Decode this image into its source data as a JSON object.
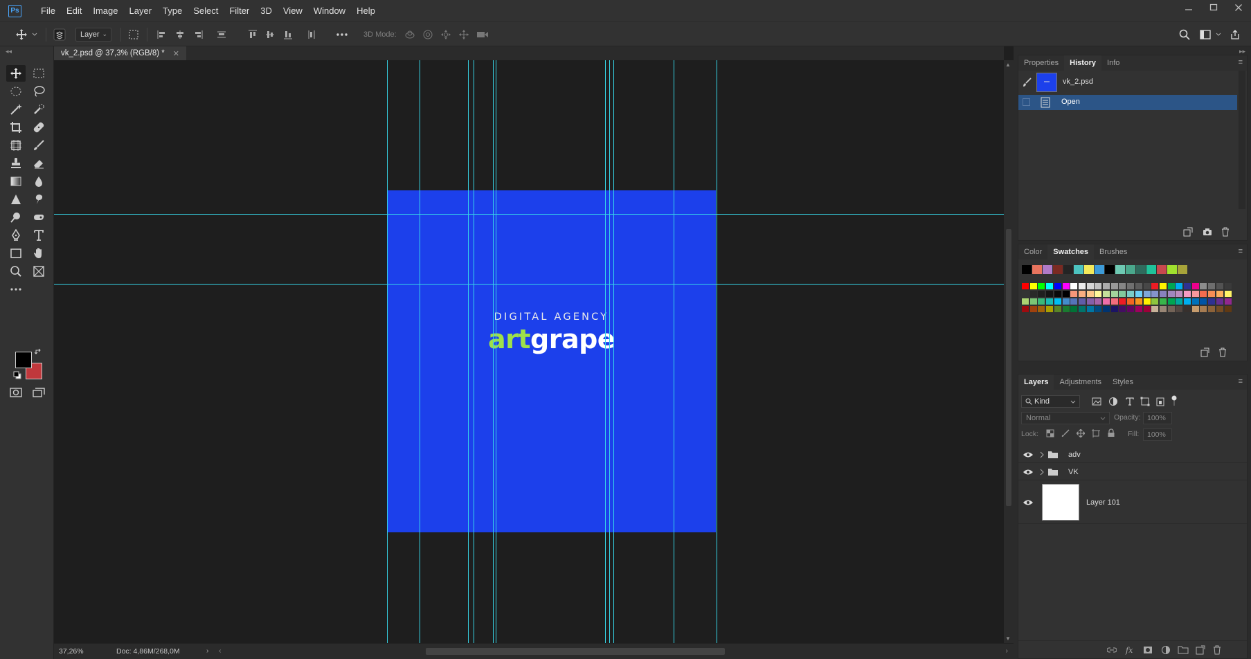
{
  "app": {
    "logo_text": "Ps"
  },
  "menu": [
    "File",
    "Edit",
    "Image",
    "Layer",
    "Type",
    "Select",
    "Filter",
    "3D",
    "View",
    "Window",
    "Help"
  ],
  "options_bar": {
    "auto_select_target": "Layer",
    "mode_3d_label": "3D Mode:"
  },
  "document": {
    "tab_title": "vk_2.psd @ 37,3% (RGB/8) *",
    "logo_subtitle": "DIGITAL AGENCY",
    "logo_part1": "art",
    "logo_part2": "grape",
    "artboard_color": "#1c40eb",
    "guide_color": "#36d6e8"
  },
  "status": {
    "zoom": "37,26%",
    "doc_info": "Doc: 4,86M/268,0M"
  },
  "history_panel": {
    "tabs": [
      "Properties",
      "History",
      "Info"
    ],
    "active_tab": "History",
    "snapshot_name": "vk_2.psd",
    "states": [
      "Open"
    ]
  },
  "swatches_panel": {
    "tabs": [
      "Color",
      "Swatches",
      "Brushes"
    ],
    "active_tab": "Swatches",
    "recent": [
      "#000000",
      "#e8745e",
      "#b07ac8",
      "#7a2a22",
      "#242424",
      "#4cc3c0",
      "#f3e85a",
      "#3d9bd8",
      "#000000",
      "#6ec9b3",
      "#4aa88c",
      "#2f6b5d",
      "#20c29a",
      "#c8484e",
      "#a0e12e",
      "#a8a43a"
    ],
    "grid": [
      [
        "#ff0000",
        "#ffff00",
        "#00ff00",
        "#00ffff",
        "#0000ff",
        "#ff00ff",
        "#ffffff",
        "#ebebeb",
        "#d6d6d6",
        "#c2c2c2",
        "#adadad",
        "#999999",
        "#858585",
        "#707070",
        "#5c5c5c",
        "#474747",
        "#ed1c24",
        "#fff200",
        "#00a651",
        "#00aeef",
        "#2e3192",
        "#ec008c",
        "#8c8c8c",
        "#6e6e6e",
        "#525252",
        "#3a3a3a"
      ],
      [
        "#333333",
        "#292929",
        "#1f1f1f",
        "#141414",
        "#0a0a0a",
        "#000000",
        "#f7977a",
        "#f9ad81",
        "#fdc68a",
        "#fff79a",
        "#c4df9b",
        "#a3d39c",
        "#82ca9d",
        "#7accc8",
        "#6dcff6",
        "#7ea7d8",
        "#8493ca",
        "#8882be",
        "#a187be",
        "#bc8dbf",
        "#f49ac2",
        "#f6989d",
        "#f26c4f",
        "#f68e55",
        "#fbaf5c",
        "#fff467"
      ],
      [
        "#acd372",
        "#7cc576",
        "#3bb878",
        "#1abbb4",
        "#00bff3",
        "#438ccb",
        "#5574b9",
        "#605ca8",
        "#855fa8",
        "#a763a8",
        "#f06ea9",
        "#f26d7d",
        "#ed1c24",
        "#f26522",
        "#f7941d",
        "#fff200",
        "#8dc63f",
        "#39b54a",
        "#00a651",
        "#00a99d",
        "#00aeef",
        "#0072bc",
        "#0054a6",
        "#2e3192",
        "#662d91",
        "#92278f"
      ],
      [
        "#9e0b0f",
        "#a0410d",
        "#a36209",
        "#aba000",
        "#598527",
        "#1a7b30",
        "#007236",
        "#00746b",
        "#0076a3",
        "#004b80",
        "#003471",
        "#1b1464",
        "#440e62",
        "#630460",
        "#9e005d",
        "#9e0039",
        "#c7b299",
        "#998675",
        "#736357",
        "#534741",
        "#37302d",
        "#c69c6d",
        "#a67c52",
        "#8c6239",
        "#754c24",
        "#603913"
      ]
    ]
  },
  "layers_panel": {
    "tabs": [
      "Layers",
      "Adjustments",
      "Styles"
    ],
    "active_tab": "Layers",
    "filter": "Kind",
    "blend_mode": "Normal",
    "opacity_label": "Opacity:",
    "opacity": "100%",
    "lock_label": "Lock:",
    "fill_label": "Fill:",
    "fill": "100%",
    "layers": [
      {
        "name": "adv",
        "type": "group"
      },
      {
        "name": "VK",
        "type": "group"
      },
      {
        "name": "Layer 101",
        "type": "pixel"
      }
    ]
  }
}
